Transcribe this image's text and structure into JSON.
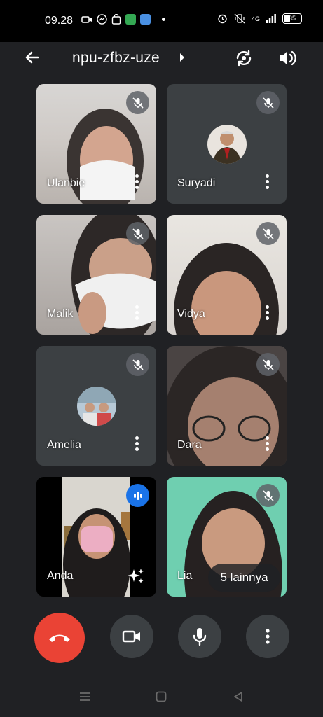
{
  "status_bar": {
    "time": "09.28",
    "network": "4G",
    "battery": "35"
  },
  "meeting": {
    "code": "npu-zfbz-uze"
  },
  "participants": [
    {
      "name": "Ulanbie",
      "muted": true,
      "video": true
    },
    {
      "name": "Suryadi",
      "muted": true,
      "video": false
    },
    {
      "name": "Malik",
      "muted": true,
      "video": true
    },
    {
      "name": "Vidya",
      "muted": true,
      "video": true
    },
    {
      "name": "Amelia",
      "muted": true,
      "video": false
    },
    {
      "name": "Dara",
      "muted": true,
      "video": true
    },
    {
      "name": "Anda",
      "muted": false,
      "speaking": true,
      "video": true
    },
    {
      "name": "Lia",
      "muted": true,
      "video": true
    }
  ],
  "more_participants_label": "5 lainnya",
  "controls": {
    "end_call": "end-call",
    "camera": "camera",
    "microphone": "microphone",
    "more": "more-options"
  },
  "colors": {
    "end_call": "#ea4335",
    "background": "#202124",
    "speaking_indicator": "#1a73e8"
  }
}
